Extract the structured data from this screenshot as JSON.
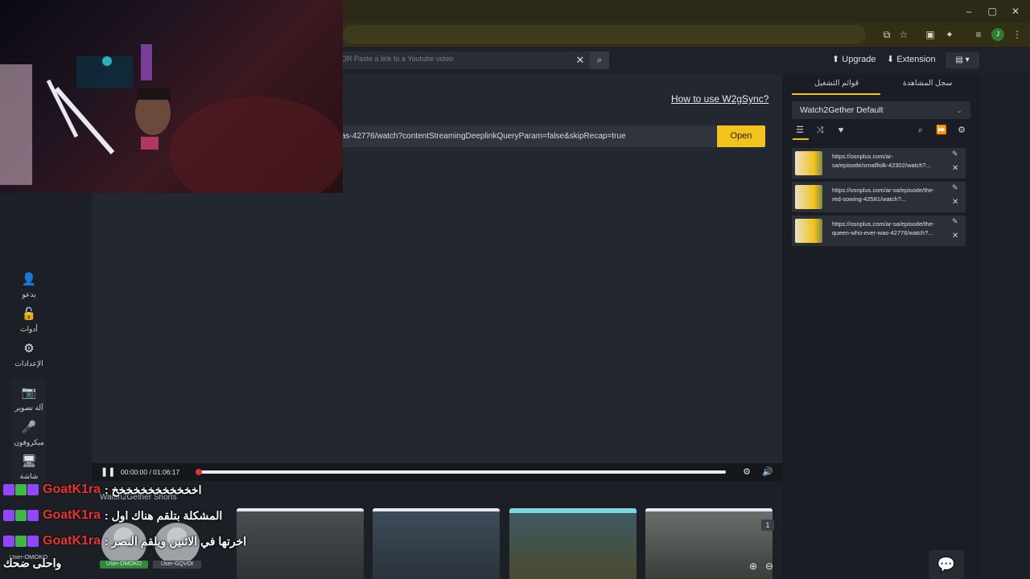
{
  "browser": {
    "window_controls": {
      "minimize": "–",
      "maximize": "▢",
      "close": "✕"
    },
    "profile_initial": "J"
  },
  "header": {
    "search_placeholder": "OR Paste a link to a Youtube video",
    "upgrade": "Upgrade",
    "extension": "Extension"
  },
  "main": {
    "howto": "How to use W2gSync?",
    "url_value": "as-42776/watch?contentStreamingDeeplinkQueryParam=false&skipRecap=true",
    "open_button": "Open"
  },
  "left_nav": {
    "invite": "يدعو",
    "tools": "أدوات",
    "settings": "الإعدادات",
    "camera": "آلة تصوير",
    "microphone": "ميكروفون",
    "screen": "شاشة"
  },
  "side_panel": {
    "tab_playlists": "قوائم التشغيل",
    "tab_history": "سجل المشاهدة",
    "playlist_name": "Watch2Gether Default",
    "items": [
      {
        "url": "https://osnplus.com/ar-sa/episode/smallfolk-42302/watch?..."
      },
      {
        "url": "https://osnplus.com/ar-sa/episode/the-red-sowing-42581/watch?..."
      },
      {
        "url": "https://osnplus.com/ar-sa/episode/the-queen-who-ever-was-42776/watch?..."
      }
    ]
  },
  "player": {
    "time": "00:00:00 / 01:06:17",
    "progress": 0.004
  },
  "shorts": {
    "title": "Watch2Gether Shorts",
    "badge": "1"
  },
  "users": [
    {
      "name": "User-OMOKO"
    },
    {
      "name": "User-GQVOI"
    }
  ],
  "user_label": "User-OMOKO",
  "chat": [
    {
      "user": "GoatK1ra",
      "message": "اخخخخخخخخخخخخ :"
    },
    {
      "user": "GoatK1ra",
      "message": "المشكلة بتلقم هناك اول :"
    },
    {
      "user": "GoatK1ra",
      "message": "اخرتها في الاثنين ويلقم النصر :"
    }
  ],
  "chat_continuation": "واحلى ضحك",
  "colors": {
    "accent": "#f2c31b",
    "seek": "#e23030",
    "chat_user": "#e8342c"
  }
}
